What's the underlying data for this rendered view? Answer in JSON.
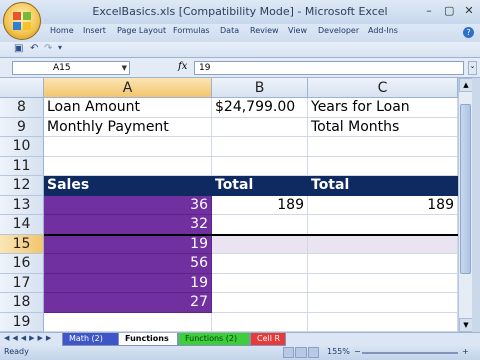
{
  "window": {
    "title": "ExcelBasics.xls  [Compatibility Mode] - Microsoft Excel",
    "controls": [
      "–",
      "▢",
      "✕"
    ]
  },
  "ribbon": {
    "tabs": [
      "Home",
      "Insert",
      "Page Layout",
      "Formulas",
      "Data",
      "Review",
      "View",
      "Developer",
      "Add-Ins"
    ],
    "help": "?"
  },
  "quick_access": [
    "save-icon",
    "undo-icon",
    "redo-icon",
    "customize-icon"
  ],
  "formula_bar": {
    "name_box": "A15",
    "fx": "fx",
    "value": "19"
  },
  "columns": [
    {
      "label": "A",
      "selected": true
    },
    {
      "label": "B",
      "selected": false
    },
    {
      "label": "C",
      "selected": false
    }
  ],
  "rows": [
    {
      "num": "8",
      "a": "Loan Amount",
      "b": "$24,799.00",
      "c": "Years for Loan",
      "style": "plain"
    },
    {
      "num": "9",
      "a": "Monthly Payment",
      "b": "",
      "c": "Total Months",
      "style": "plain"
    },
    {
      "num": "10",
      "a": "",
      "b": "",
      "c": "",
      "style": "plain"
    },
    {
      "num": "11",
      "a": "",
      "b": "",
      "c": "",
      "style": "plain"
    },
    {
      "num": "12",
      "a": "Sales",
      "b": "Total",
      "c": "Total",
      "style": "header"
    },
    {
      "num": "13",
      "a": "36",
      "b": "189",
      "c": "189",
      "style": "data"
    },
    {
      "num": "14",
      "a": "32",
      "b": "",
      "c": "",
      "style": "data"
    },
    {
      "num": "15",
      "a": "19",
      "b": "",
      "c": "",
      "style": "data-selected"
    },
    {
      "num": "16",
      "a": "56",
      "b": "",
      "c": "",
      "style": "data"
    },
    {
      "num": "17",
      "a": "19",
      "b": "",
      "c": "",
      "style": "data"
    },
    {
      "num": "18",
      "a": "27",
      "b": "",
      "c": "",
      "style": "data"
    },
    {
      "num": "19",
      "a": "",
      "b": "",
      "c": "",
      "style": "plain"
    }
  ],
  "sheets": [
    {
      "label": "Math (2)",
      "color": "#3f56c8",
      "active": false
    },
    {
      "label": "Functions",
      "color": "#ffffff",
      "active": true
    },
    {
      "label": "Functions (2)",
      "color": "#3ccf3a",
      "active": false
    },
    {
      "label": "Cell R",
      "color": "#e83a3a",
      "active": false
    }
  ],
  "status": {
    "ready": "Ready",
    "zoom": "155%",
    "zoom_minus": "−",
    "zoom_plus": "+"
  }
}
